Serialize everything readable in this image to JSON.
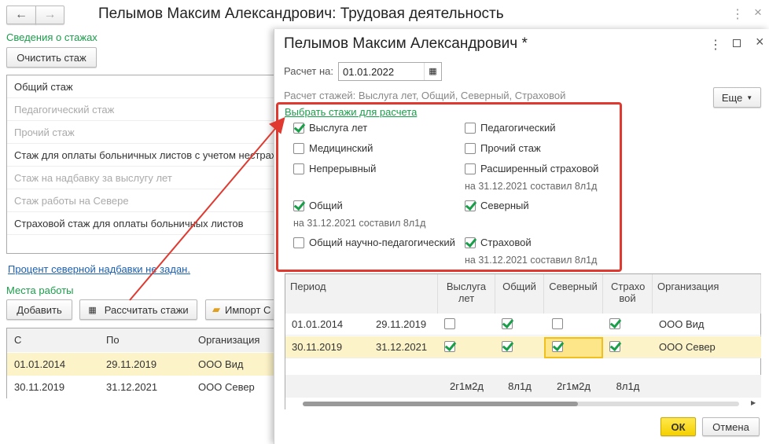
{
  "main": {
    "title": "Пелымов Максим Александрович: Трудовая деятельность",
    "section_stazh": "Сведения о стажах",
    "clear_button": "Очистить стаж",
    "stazh_list": [
      {
        "label": "Общий стаж",
        "dim": false
      },
      {
        "label": "Педагогический стаж",
        "dim": true
      },
      {
        "label": "Прочий стаж",
        "dim": true
      },
      {
        "label": "Стаж для оплаты больничных листов с учетом нестрах",
        "dim": false
      },
      {
        "label": "Стаж на надбавку за выслугу лет",
        "dim": true
      },
      {
        "label": "Стаж работы на Севере",
        "dim": true
      },
      {
        "label": "Страховой стаж для оплаты больничных листов",
        "dim": false
      }
    ],
    "north_link": "Процент северной надбавки не задан.",
    "section_work": "Места работы",
    "add_button": "Добавить",
    "calc_button": "Рассчитать стажи",
    "import_button": "Импорт С",
    "columns": [
      "С",
      "По",
      "Организация"
    ],
    "rows": [
      [
        "01.01.2014",
        "29.11.2019",
        "ООО Вид"
      ],
      [
        "30.11.2019",
        "31.12.2021",
        "ООО Север"
      ]
    ]
  },
  "dialog": {
    "title": "Пелымов Максим Александрович *",
    "date_label": "Расчет на:",
    "date_value": "01.01.2022",
    "summary": "Расчет стажей: Выслуга лет, Общий, Северный, Страховой",
    "more_button": "Еще",
    "choose_link": "Выбрать стажи для расчета",
    "options": [
      {
        "label": "Выслуга лет",
        "checked": true,
        "note": ""
      },
      {
        "label": "Педагогический",
        "checked": false,
        "note": ""
      },
      {
        "label": "Медицинский",
        "checked": false,
        "note": ""
      },
      {
        "label": "Прочий стаж",
        "checked": false,
        "note": ""
      },
      {
        "label": "Непрерывный",
        "checked": false,
        "note": ""
      },
      {
        "label": "Расширенный страховой",
        "checked": false,
        "note": "на 31.12.2021 составил 8л1д"
      },
      {
        "label": "Общий",
        "checked": true,
        "note": "на 31.12.2021 составил 8л1д"
      },
      {
        "label": "Северный",
        "checked": true,
        "note": ""
      },
      {
        "label": "Общий научно-педагогический",
        "checked": false,
        "note": ""
      },
      {
        "label": "Страховой",
        "checked": true,
        "note": "на 31.12.2021 составил 8л1д"
      }
    ],
    "table": {
      "period_header": "Период",
      "headers": [
        "Выслуга лет",
        "Общий",
        "Северный",
        "Страхо вой"
      ],
      "org_header": "Организация",
      "rows": [
        {
          "from": "01.01.2014",
          "to": "29.11.2019",
          "checks": [
            false,
            true,
            false,
            true
          ],
          "org": "ООО Вид"
        },
        {
          "from": "30.11.2019",
          "to": "31.12.2021",
          "checks": [
            true,
            true,
            true,
            true
          ],
          "org": "ООО Север"
        }
      ],
      "totals": [
        "2г1м2д",
        "8л1д",
        "2г1м2д",
        "8л1д"
      ]
    },
    "ok_button": "ОК",
    "cancel_button": "Отмена"
  },
  "colors": {
    "accent_green": "#1a9e4a",
    "highlight": "#fdf3c8",
    "annotation_red": "#e03a30",
    "ok_yellow": "#f5d800"
  }
}
